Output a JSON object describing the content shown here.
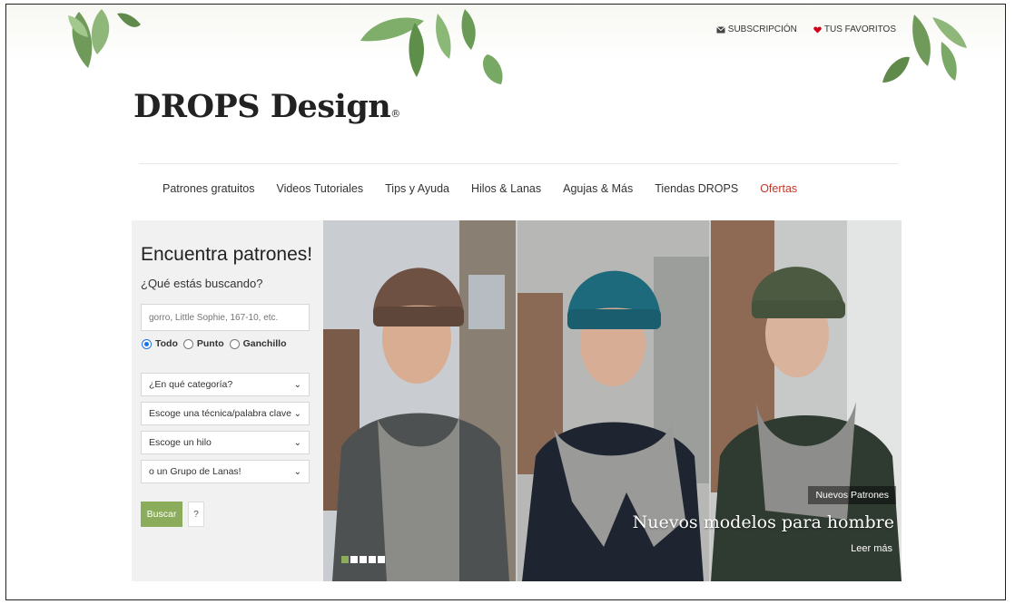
{
  "header": {
    "subscription_label": "SUBSCRIPCIÓN",
    "favorites_label": "TUS FAVORITOS",
    "logo_text": "DROPS Design",
    "logo_mark": "®"
  },
  "nav": {
    "items": [
      {
        "label": "Patrones gratuitos"
      },
      {
        "label": "Videos Tutoriales"
      },
      {
        "label": "Tips y Ayuda"
      },
      {
        "label": "Hilos & Lanas"
      },
      {
        "label": "Agujas & Más"
      },
      {
        "label": "Tiendas DROPS"
      },
      {
        "label": "Ofertas"
      }
    ]
  },
  "search": {
    "title": "Encuentra patrones!",
    "subtitle": "¿Qué estás buscando?",
    "placeholder": "gorro, Little Sophie, 167-10, etc.",
    "radios": [
      {
        "label": "Todo",
        "selected": true
      },
      {
        "label": "Punto",
        "selected": false
      },
      {
        "label": "Ganchillo",
        "selected": false
      }
    ],
    "selects": [
      {
        "label": "¿En qué categoría?"
      },
      {
        "label": "Escoge una técnica/palabra clave"
      },
      {
        "label": "Escoge un hilo"
      },
      {
        "label": "o un Grupo de Lanas!"
      }
    ],
    "search_button": "Buscar",
    "help_button": "?"
  },
  "hero": {
    "tag": "Nuevos Patrones",
    "title": "Nuevos modelos para hombre",
    "read_more": "Leer más",
    "slide_count": 5,
    "active_slide": 1
  },
  "colors": {
    "accent_green": "#8bac5a",
    "offer_red": "#c0392b",
    "heart_red": "#d0021b"
  }
}
